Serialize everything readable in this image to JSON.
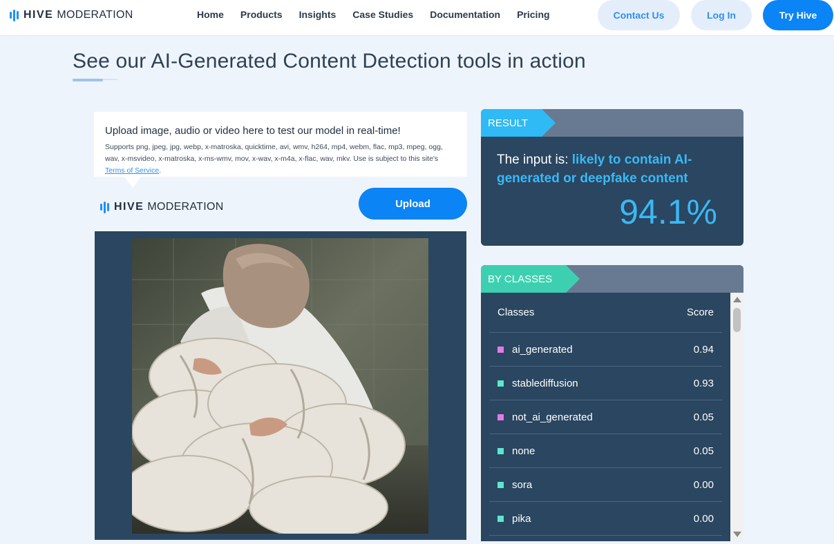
{
  "brand": {
    "word1": "HIVE",
    "word2": "MODERATION",
    "color": "#1e8fff"
  },
  "nav": {
    "links": [
      "Home",
      "Products",
      "Insights",
      "Case Studies",
      "Documentation",
      "Pricing"
    ],
    "contact_label": "Contact Us",
    "login_label": "Log In",
    "try_label": "Try Hive"
  },
  "page": {
    "title": "See our AI-Generated Content Detection tools in action"
  },
  "upload": {
    "title": "Upload image, audio or video here to test our model in real-time!",
    "formats": "Supports png, jpeg, jpg, webp, x-matroska, quicktime, avi, wmv, h264, mp4, webm, flac, mp3, mpeg, ogg, wav, x-msvideo, x-matroska, x-ms-wmv, mov, x-wav, x-m4a, x-flac, wav, mkv. Use is subject to this site's ",
    "tos_label": "Terms of Service",
    "tos_suffix": ".",
    "button_label": "Upload"
  },
  "result": {
    "tag": "RESULT",
    "prefix": "The input is: ",
    "verdict": "likely to contain AI-generated or deepfake content",
    "percent": "94.1%",
    "accent": "#3bb8f5"
  },
  "classes": {
    "tag": "BY CLASSES",
    "header_classes": "Classes",
    "header_score": "Score",
    "rows": [
      {
        "name": "ai_generated",
        "score": "0.94",
        "color": "#e27ae9"
      },
      {
        "name": "stablediffusion",
        "score": "0.93",
        "color": "#5ce6d2"
      },
      {
        "name": "not_ai_generated",
        "score": "0.05",
        "color": "#e27ae9"
      },
      {
        "name": "none",
        "score": "0.05",
        "color": "#5ce6d2"
      },
      {
        "name": "sora",
        "score": "0.00",
        "color": "#5ce6d2"
      },
      {
        "name": "pika",
        "score": "0.00",
        "color": "#5ce6d2"
      }
    ]
  }
}
